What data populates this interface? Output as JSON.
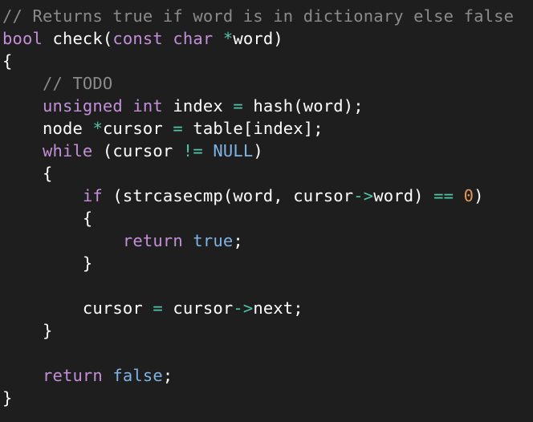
{
  "editor": {
    "language": "C",
    "colors": {
      "background": "#1e1e1e",
      "comment": "#8a8a8a",
      "keyword": "#c38fd9",
      "constant": "#7fb2e5",
      "operator": "#50c4a8",
      "number": "#e0955a",
      "plain": "#ffffff"
    },
    "lines": [
      [
        {
          "t": "// Returns true if word is in dictionary else false",
          "c": "cmt"
        }
      ],
      [
        {
          "t": "bool",
          "c": "kw"
        },
        {
          "t": " check(",
          "c": "pl"
        },
        {
          "t": "const",
          "c": "kw"
        },
        {
          "t": " ",
          "c": "pl"
        },
        {
          "t": "char",
          "c": "kw"
        },
        {
          "t": " ",
          "c": "pl"
        },
        {
          "t": "*",
          "c": "op"
        },
        {
          "t": "word)",
          "c": "pl"
        }
      ],
      [
        {
          "t": "{",
          "c": "pl"
        }
      ],
      [
        {
          "t": "    ",
          "c": "pl"
        },
        {
          "t": "// TODO",
          "c": "cmt"
        }
      ],
      [
        {
          "t": "    ",
          "c": "pl"
        },
        {
          "t": "unsigned",
          "c": "kw"
        },
        {
          "t": " ",
          "c": "pl"
        },
        {
          "t": "int",
          "c": "kw"
        },
        {
          "t": " index ",
          "c": "pl"
        },
        {
          "t": "=",
          "c": "op"
        },
        {
          "t": " hash(word);",
          "c": "pl"
        }
      ],
      [
        {
          "t": "    node ",
          "c": "pl"
        },
        {
          "t": "*",
          "c": "op"
        },
        {
          "t": "cursor ",
          "c": "pl"
        },
        {
          "t": "=",
          "c": "op"
        },
        {
          "t": " table[index];",
          "c": "pl"
        }
      ],
      [
        {
          "t": "    ",
          "c": "pl"
        },
        {
          "t": "while",
          "c": "kw"
        },
        {
          "t": " (cursor ",
          "c": "pl"
        },
        {
          "t": "!=",
          "c": "op"
        },
        {
          "t": " ",
          "c": "pl"
        },
        {
          "t": "NULL",
          "c": "con"
        },
        {
          "t": ")",
          "c": "pl"
        }
      ],
      [
        {
          "t": "    {",
          "c": "pl"
        }
      ],
      [
        {
          "t": "        ",
          "c": "pl"
        },
        {
          "t": "if",
          "c": "kw"
        },
        {
          "t": " (strcasecmp(word, cursor",
          "c": "pl"
        },
        {
          "t": "->",
          "c": "op"
        },
        {
          "t": "word) ",
          "c": "pl"
        },
        {
          "t": "==",
          "c": "op"
        },
        {
          "t": " ",
          "c": "pl"
        },
        {
          "t": "0",
          "c": "num"
        },
        {
          "t": ")",
          "c": "pl"
        }
      ],
      [
        {
          "t": "        {",
          "c": "pl"
        }
      ],
      [
        {
          "t": "            ",
          "c": "pl"
        },
        {
          "t": "return",
          "c": "kw"
        },
        {
          "t": " ",
          "c": "pl"
        },
        {
          "t": "true",
          "c": "con"
        },
        {
          "t": ";",
          "c": "pl"
        }
      ],
      [
        {
          "t": "        }",
          "c": "pl"
        }
      ],
      [],
      [
        {
          "t": "        cursor ",
          "c": "pl"
        },
        {
          "t": "=",
          "c": "op"
        },
        {
          "t": " cursor",
          "c": "pl"
        },
        {
          "t": "->",
          "c": "op"
        },
        {
          "t": "next;",
          "c": "pl"
        }
      ],
      [
        {
          "t": "    }",
          "c": "pl"
        }
      ],
      [],
      [
        {
          "t": "    ",
          "c": "pl"
        },
        {
          "t": "return",
          "c": "kw"
        },
        {
          "t": " ",
          "c": "pl"
        },
        {
          "t": "false",
          "c": "con"
        },
        {
          "t": ";",
          "c": "pl"
        }
      ],
      [
        {
          "t": "}",
          "c": "pl"
        }
      ]
    ]
  }
}
